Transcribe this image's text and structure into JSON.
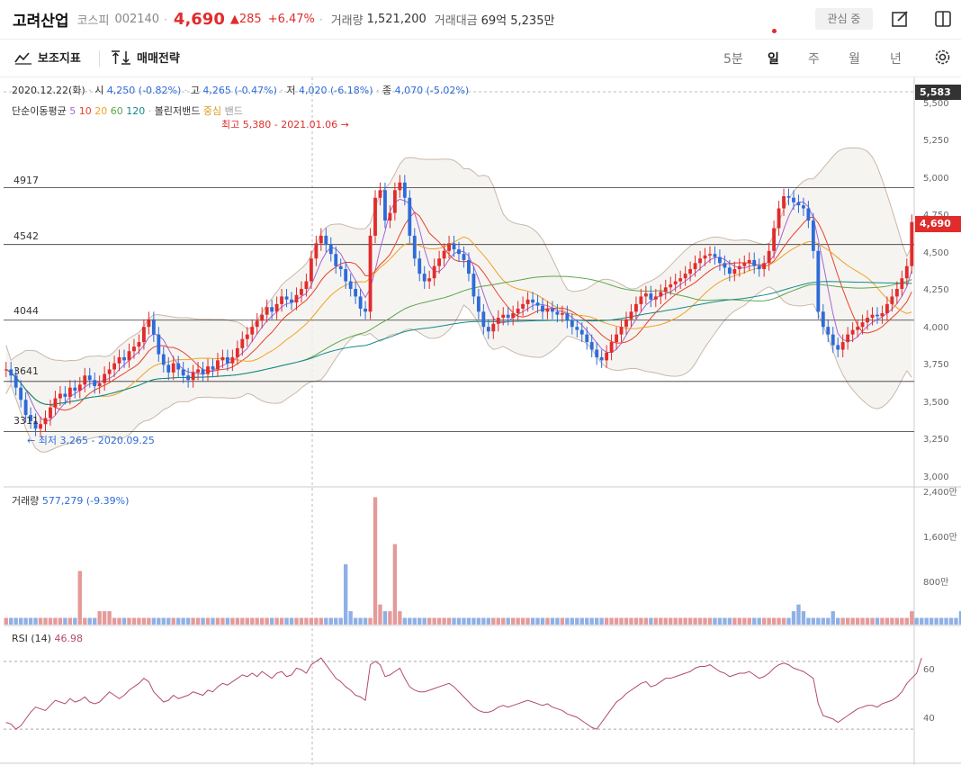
{
  "header": {
    "name": "고려산업",
    "market": "코스피",
    "code": "002140",
    "price": "4,690",
    "change": "285",
    "change_pct": "+6.47%",
    "volume_label": "거래량",
    "volume_value": "1,521,200",
    "amount_label": "거래대금",
    "amount_value": "69억 5,235만",
    "fav_button": "관심 중",
    "icons": [
      "edit-icon",
      "panel-icon"
    ]
  },
  "toolbar": {
    "indicator_button": "보조지표",
    "strategy_button": "매매전략",
    "periods": [
      "5분",
      "일",
      "주",
      "월",
      "년"
    ],
    "active_period": "일",
    "icons": [
      "indicator-icon",
      "sort-icon",
      "settings-icon"
    ]
  },
  "ohlc": {
    "date": "2020.12.22(화)",
    "open_label": "시",
    "open": "4,250 (-0.82%)",
    "high_label": "고",
    "high": "4,265 (-0.47%)",
    "low_label": "저",
    "low": "4,020 (-6.18%)",
    "close_label": "종",
    "close": "4,070 (-5.02%)"
  },
  "ma_legend": {
    "label": "단순이동평균",
    "periods": [
      "5",
      "10",
      "20",
      "60",
      "120"
    ],
    "bb_label": "볼린저밴드",
    "bb_center": "중심",
    "bb_band": "밴드"
  },
  "annotations": {
    "high": "최고 5,380 - 2021.01.06",
    "low": "최저 3,265 - 2020.09.25"
  },
  "hlines": [
    "4917",
    "4542",
    "4044",
    "3641",
    "3311"
  ],
  "price_axis": [
    "5,500",
    "5,250",
    "5,000",
    "4,750",
    "4,500",
    "4,250",
    "4,000",
    "3,750",
    "3,500",
    "3,250",
    "3,000"
  ],
  "price_badges": {
    "current": "4,690",
    "high": "5,583"
  },
  "volume": {
    "label": "거래량",
    "value": "577,279 (-9.39%)",
    "axis": [
      "2,400만",
      "1,600만",
      "800만"
    ]
  },
  "rsi": {
    "label": "RSI (14)",
    "value": "46.98",
    "axis": [
      "60",
      "40"
    ]
  },
  "colors": {
    "up": "#e12c2c",
    "down": "#2e6bd8",
    "ma5": "#a566d6",
    "ma10": "#e8412a",
    "ma20": "#f0a224",
    "ma60": "#5aa64a",
    "ma120": "#138a8a",
    "rsi": "#b24a6e"
  },
  "chart_data": {
    "type": "candlestick",
    "price_ylim": [
      3000,
      5500
    ],
    "rsi_ylim": [
      20,
      80
    ],
    "volume_ylim": [
      0,
      24000000
    ],
    "hlines": [
      4917,
      4542,
      4044,
      3641,
      3311
    ],
    "closes": [
      3720,
      3680,
      3600,
      3520,
      3420,
      3380,
      3330,
      3360,
      3400,
      3470,
      3530,
      3560,
      3540,
      3600,
      3580,
      3620,
      3680,
      3650,
      3610,
      3630,
      3690,
      3720,
      3760,
      3800,
      3780,
      3840,
      3870,
      3900,
      4000,
      4050,
      3950,
      3820,
      3750,
      3700,
      3760,
      3720,
      3680,
      3650,
      3700,
      3720,
      3690,
      3740,
      3720,
      3780,
      3800,
      3760,
      3800,
      3860,
      3920,
      3950,
      4000,
      4040,
      4080,
      4130,
      4100,
      4150,
      4200,
      4180,
      4160,
      4210,
      4250,
      4300,
      4450,
      4550,
      4600,
      4540,
      4480,
      4400,
      4380,
      4300,
      4250,
      4200,
      4120,
      4100,
      4600,
      4850,
      4900,
      4700,
      4750,
      4900,
      4950,
      4850,
      4600,
      4450,
      4350,
      4300,
      4320,
      4400,
      4450,
      4500,
      4550,
      4510,
      4480,
      4440,
      4350,
      4200,
      4100,
      4000,
      3970,
      4020,
      4060,
      4080,
      4060,
      4090,
      4120,
      4150,
      4180,
      4160,
      4140,
      4100,
      4120,
      4100,
      4080,
      4090,
      4040,
      4000,
      3980,
      3950,
      3900,
      3850,
      3800,
      3780,
      3830,
      3900,
      3950,
      4000,
      4050,
      4100,
      4150,
      4200,
      4220,
      4180,
      4200,
      4230,
      4260,
      4280,
      4300,
      4320,
      4350,
      4380,
      4420,
      4450,
      4470,
      4480,
      4460,
      4420,
      4390,
      4350,
      4380,
      4400,
      4420,
      4440,
      4400,
      4380,
      4420,
      4500,
      4650,
      4780,
      4860,
      4850,
      4820,
      4800,
      4780,
      4700,
      4500,
      4100,
      4000,
      3950,
      3880,
      3850,
      3900,
      3950,
      3980,
      4000,
      4030,
      4060,
      4080,
      4070,
      4090,
      4150,
      4200,
      4250,
      4320,
      4400,
      4690
    ],
    "rsi": [
      34,
      33,
      30,
      32,
      36,
      40,
      43,
      42,
      41,
      44,
      47,
      46,
      45,
      48,
      46,
      47,
      49,
      46,
      45,
      46,
      49,
      52,
      50,
      48,
      50,
      53,
      55,
      57,
      60,
      58,
      52,
      49,
      46,
      47,
      50,
      48,
      49,
      50,
      52,
      51,
      50,
      53,
      52,
      55,
      57,
      56,
      58,
      60,
      62,
      61,
      63,
      61,
      64,
      62,
      60,
      63,
      64,
      61,
      62,
      66,
      65,
      63,
      68,
      70,
      72,
      68,
      64,
      60,
      58,
      55,
      53,
      50,
      49,
      47,
      68,
      70,
      68,
      61,
      62,
      64,
      66,
      60,
      55,
      53,
      52,
      52,
      53,
      54,
      55,
      56,
      57,
      55,
      52,
      49,
      46,
      43,
      41,
      40,
      40,
      41,
      43,
      44,
      43,
      44,
      45,
      46,
      47,
      46,
      45,
      44,
      45,
      43,
      42,
      41,
      39,
      38,
      37,
      35,
      33,
      31,
      30,
      34,
      38,
      42,
      46,
      48,
      51,
      53,
      55,
      57,
      58,
      55,
      56,
      58,
      60,
      60,
      61,
      62,
      63,
      64,
      66,
      67,
      67,
      68,
      66,
      64,
      63,
      61,
      62,
      63,
      63,
      64,
      62,
      60,
      61,
      63,
      66,
      68,
      69,
      68,
      66,
      65,
      64,
      62,
      60,
      45,
      38,
      37,
      36,
      34,
      36,
      38,
      40,
      42,
      43,
      44,
      44,
      43,
      45,
      46,
      47,
      49,
      52,
      57,
      60,
      63,
      72
    ],
    "volumes": [
      1,
      1,
      1,
      1,
      1,
      1,
      1,
      1,
      1,
      1,
      1,
      1,
      1,
      1,
      1,
      8,
      1,
      1,
      1,
      2,
      2,
      2,
      1,
      1,
      1,
      1,
      1,
      1,
      1,
      1,
      1,
      1,
      1,
      1,
      1,
      1,
      1,
      1,
      1,
      1,
      1,
      1,
      1,
      1,
      1,
      1,
      1,
      1,
      1,
      1,
      1,
      1,
      1,
      1,
      1,
      1,
      1,
      1,
      1,
      1,
      1,
      1,
      1,
      1,
      1,
      1,
      1,
      1,
      1,
      9,
      2,
      1,
      1,
      1,
      1,
      19,
      3,
      2,
      2,
      12,
      2,
      1,
      1,
      1,
      1,
      1,
      1,
      1,
      1,
      1,
      1,
      1,
      1,
      1,
      1,
      1,
      1,
      1,
      1,
      1,
      1,
      1,
      1,
      1,
      1,
      1,
      1,
      1,
      1,
      1,
      1,
      1,
      1,
      1,
      1,
      1,
      1,
      1,
      1,
      1,
      1,
      1,
      1,
      1,
      1,
      1,
      1,
      1,
      1,
      1,
      1,
      1,
      1,
      1,
      1,
      1,
      1,
      1,
      1,
      1,
      1,
      1,
      1,
      1,
      1,
      1,
      1,
      1,
      1,
      1,
      1,
      1,
      1,
      1,
      1,
      1,
      1,
      1,
      1,
      1,
      2,
      3,
      2,
      1,
      1,
      1,
      1,
      1,
      2,
      1,
      1,
      1,
      1,
      1,
      1,
      1,
      1,
      1,
      1,
      1,
      1,
      1,
      1,
      1,
      2,
      1,
      1,
      1,
      1,
      1,
      1,
      1,
      1,
      1,
      2,
      1,
      3
    ]
  }
}
